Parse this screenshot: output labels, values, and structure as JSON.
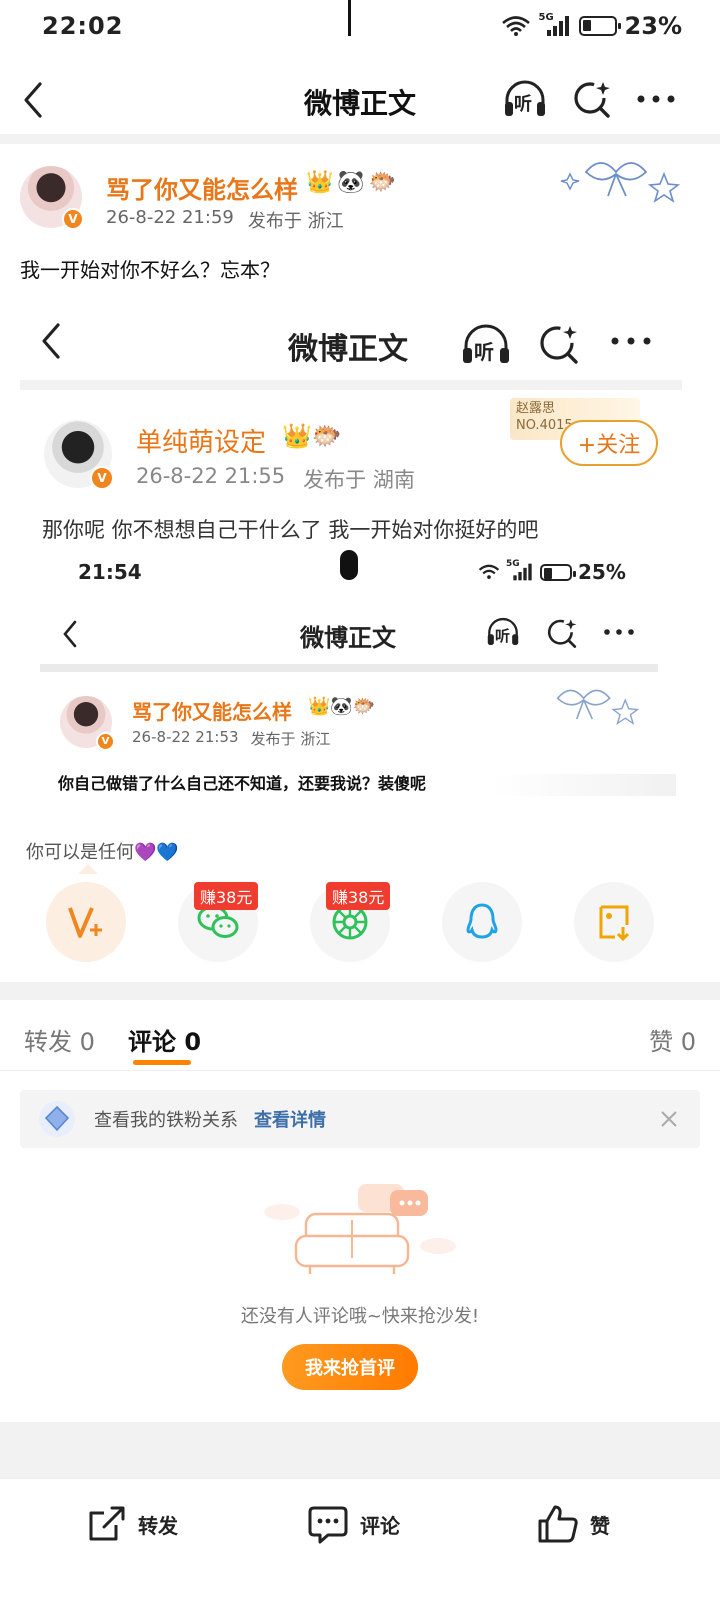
{
  "status": {
    "time": "22:02",
    "network": "5G",
    "battery": "23%"
  },
  "nav": {
    "title": "微博正文",
    "listen_label": "听"
  },
  "post": {
    "author": "骂了你又能怎么样",
    "date": "26-8-22 21:59",
    "location": "发布于 浙江",
    "text": "我一开始对你不好么？忘本？"
  },
  "screenshot1": {
    "nav_title": "微博正文",
    "listen_label": "听",
    "author": "单纯萌设定",
    "date": "26-8-22 21:55",
    "location": "发布于 湖南",
    "text": "那你呢 你不想想自己干什么了 我一开始对你挺好的吧",
    "follow_label": "+关注",
    "card_name": "赵露思",
    "card_no": "NO.4015"
  },
  "screenshot2": {
    "time": "21:54",
    "network": "5G",
    "battery": "25%",
    "nav_title": "微博正文",
    "listen_label": "听",
    "author": "骂了你又能怎么样",
    "date": "26-8-22 21:53",
    "location": "发布于 浙江",
    "text": "你自己做错了什么自己还不知道，还要我说？装傻呢"
  },
  "share": {
    "prompt": "你可以是任何💜💙",
    "reward_1": "赚38元",
    "reward_2": "赚38元"
  },
  "tabs": {
    "repost": "转发 0",
    "comment": "评论 0",
    "like": "赞 0"
  },
  "fan_banner": {
    "text": "查看我的铁粉关系",
    "link": "查看详情"
  },
  "empty": {
    "message": "还没有人评论哦~快来抢沙发!",
    "button": "我来抢首评"
  },
  "bottom": {
    "repost": "转发",
    "comment": "评论",
    "like": "赞"
  },
  "colors": {
    "accent": "#ff8200",
    "link": "#3d6fa8",
    "reward": "#f03c2e"
  }
}
